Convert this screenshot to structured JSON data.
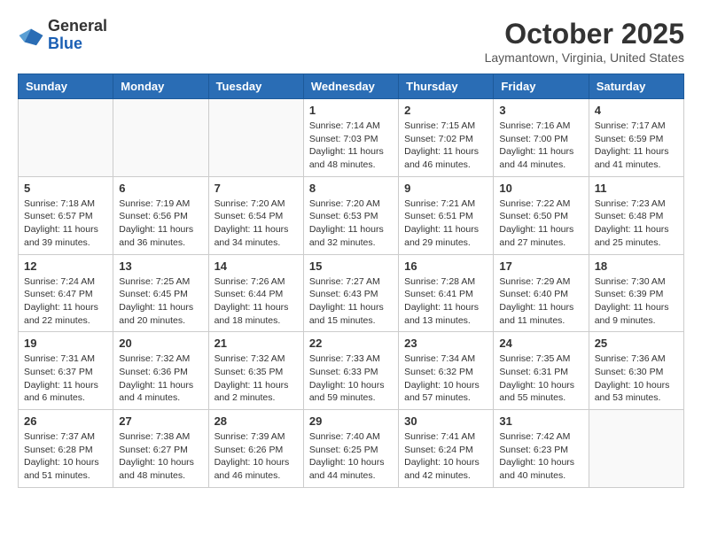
{
  "logo": {
    "general": "General",
    "blue": "Blue"
  },
  "title": "October 2025",
  "location": "Laymantown, Virginia, United States",
  "days_of_week": [
    "Sunday",
    "Monday",
    "Tuesday",
    "Wednesday",
    "Thursday",
    "Friday",
    "Saturday"
  ],
  "weeks": [
    [
      {
        "day": "",
        "info": ""
      },
      {
        "day": "",
        "info": ""
      },
      {
        "day": "",
        "info": ""
      },
      {
        "day": "1",
        "info": "Sunrise: 7:14 AM\nSunset: 7:03 PM\nDaylight: 11 hours and 48 minutes."
      },
      {
        "day": "2",
        "info": "Sunrise: 7:15 AM\nSunset: 7:02 PM\nDaylight: 11 hours and 46 minutes."
      },
      {
        "day": "3",
        "info": "Sunrise: 7:16 AM\nSunset: 7:00 PM\nDaylight: 11 hours and 44 minutes."
      },
      {
        "day": "4",
        "info": "Sunrise: 7:17 AM\nSunset: 6:59 PM\nDaylight: 11 hours and 41 minutes."
      }
    ],
    [
      {
        "day": "5",
        "info": "Sunrise: 7:18 AM\nSunset: 6:57 PM\nDaylight: 11 hours and 39 minutes."
      },
      {
        "day": "6",
        "info": "Sunrise: 7:19 AM\nSunset: 6:56 PM\nDaylight: 11 hours and 36 minutes."
      },
      {
        "day": "7",
        "info": "Sunrise: 7:20 AM\nSunset: 6:54 PM\nDaylight: 11 hours and 34 minutes."
      },
      {
        "day": "8",
        "info": "Sunrise: 7:20 AM\nSunset: 6:53 PM\nDaylight: 11 hours and 32 minutes."
      },
      {
        "day": "9",
        "info": "Sunrise: 7:21 AM\nSunset: 6:51 PM\nDaylight: 11 hours and 29 minutes."
      },
      {
        "day": "10",
        "info": "Sunrise: 7:22 AM\nSunset: 6:50 PM\nDaylight: 11 hours and 27 minutes."
      },
      {
        "day": "11",
        "info": "Sunrise: 7:23 AM\nSunset: 6:48 PM\nDaylight: 11 hours and 25 minutes."
      }
    ],
    [
      {
        "day": "12",
        "info": "Sunrise: 7:24 AM\nSunset: 6:47 PM\nDaylight: 11 hours and 22 minutes."
      },
      {
        "day": "13",
        "info": "Sunrise: 7:25 AM\nSunset: 6:45 PM\nDaylight: 11 hours and 20 minutes."
      },
      {
        "day": "14",
        "info": "Sunrise: 7:26 AM\nSunset: 6:44 PM\nDaylight: 11 hours and 18 minutes."
      },
      {
        "day": "15",
        "info": "Sunrise: 7:27 AM\nSunset: 6:43 PM\nDaylight: 11 hours and 15 minutes."
      },
      {
        "day": "16",
        "info": "Sunrise: 7:28 AM\nSunset: 6:41 PM\nDaylight: 11 hours and 13 minutes."
      },
      {
        "day": "17",
        "info": "Sunrise: 7:29 AM\nSunset: 6:40 PM\nDaylight: 11 hours and 11 minutes."
      },
      {
        "day": "18",
        "info": "Sunrise: 7:30 AM\nSunset: 6:39 PM\nDaylight: 11 hours and 9 minutes."
      }
    ],
    [
      {
        "day": "19",
        "info": "Sunrise: 7:31 AM\nSunset: 6:37 PM\nDaylight: 11 hours and 6 minutes."
      },
      {
        "day": "20",
        "info": "Sunrise: 7:32 AM\nSunset: 6:36 PM\nDaylight: 11 hours and 4 minutes."
      },
      {
        "day": "21",
        "info": "Sunrise: 7:32 AM\nSunset: 6:35 PM\nDaylight: 11 hours and 2 minutes."
      },
      {
        "day": "22",
        "info": "Sunrise: 7:33 AM\nSunset: 6:33 PM\nDaylight: 10 hours and 59 minutes."
      },
      {
        "day": "23",
        "info": "Sunrise: 7:34 AM\nSunset: 6:32 PM\nDaylight: 10 hours and 57 minutes."
      },
      {
        "day": "24",
        "info": "Sunrise: 7:35 AM\nSunset: 6:31 PM\nDaylight: 10 hours and 55 minutes."
      },
      {
        "day": "25",
        "info": "Sunrise: 7:36 AM\nSunset: 6:30 PM\nDaylight: 10 hours and 53 minutes."
      }
    ],
    [
      {
        "day": "26",
        "info": "Sunrise: 7:37 AM\nSunset: 6:28 PM\nDaylight: 10 hours and 51 minutes."
      },
      {
        "day": "27",
        "info": "Sunrise: 7:38 AM\nSunset: 6:27 PM\nDaylight: 10 hours and 48 minutes."
      },
      {
        "day": "28",
        "info": "Sunrise: 7:39 AM\nSunset: 6:26 PM\nDaylight: 10 hours and 46 minutes."
      },
      {
        "day": "29",
        "info": "Sunrise: 7:40 AM\nSunset: 6:25 PM\nDaylight: 10 hours and 44 minutes."
      },
      {
        "day": "30",
        "info": "Sunrise: 7:41 AM\nSunset: 6:24 PM\nDaylight: 10 hours and 42 minutes."
      },
      {
        "day": "31",
        "info": "Sunrise: 7:42 AM\nSunset: 6:23 PM\nDaylight: 10 hours and 40 minutes."
      },
      {
        "day": "",
        "info": ""
      }
    ]
  ]
}
